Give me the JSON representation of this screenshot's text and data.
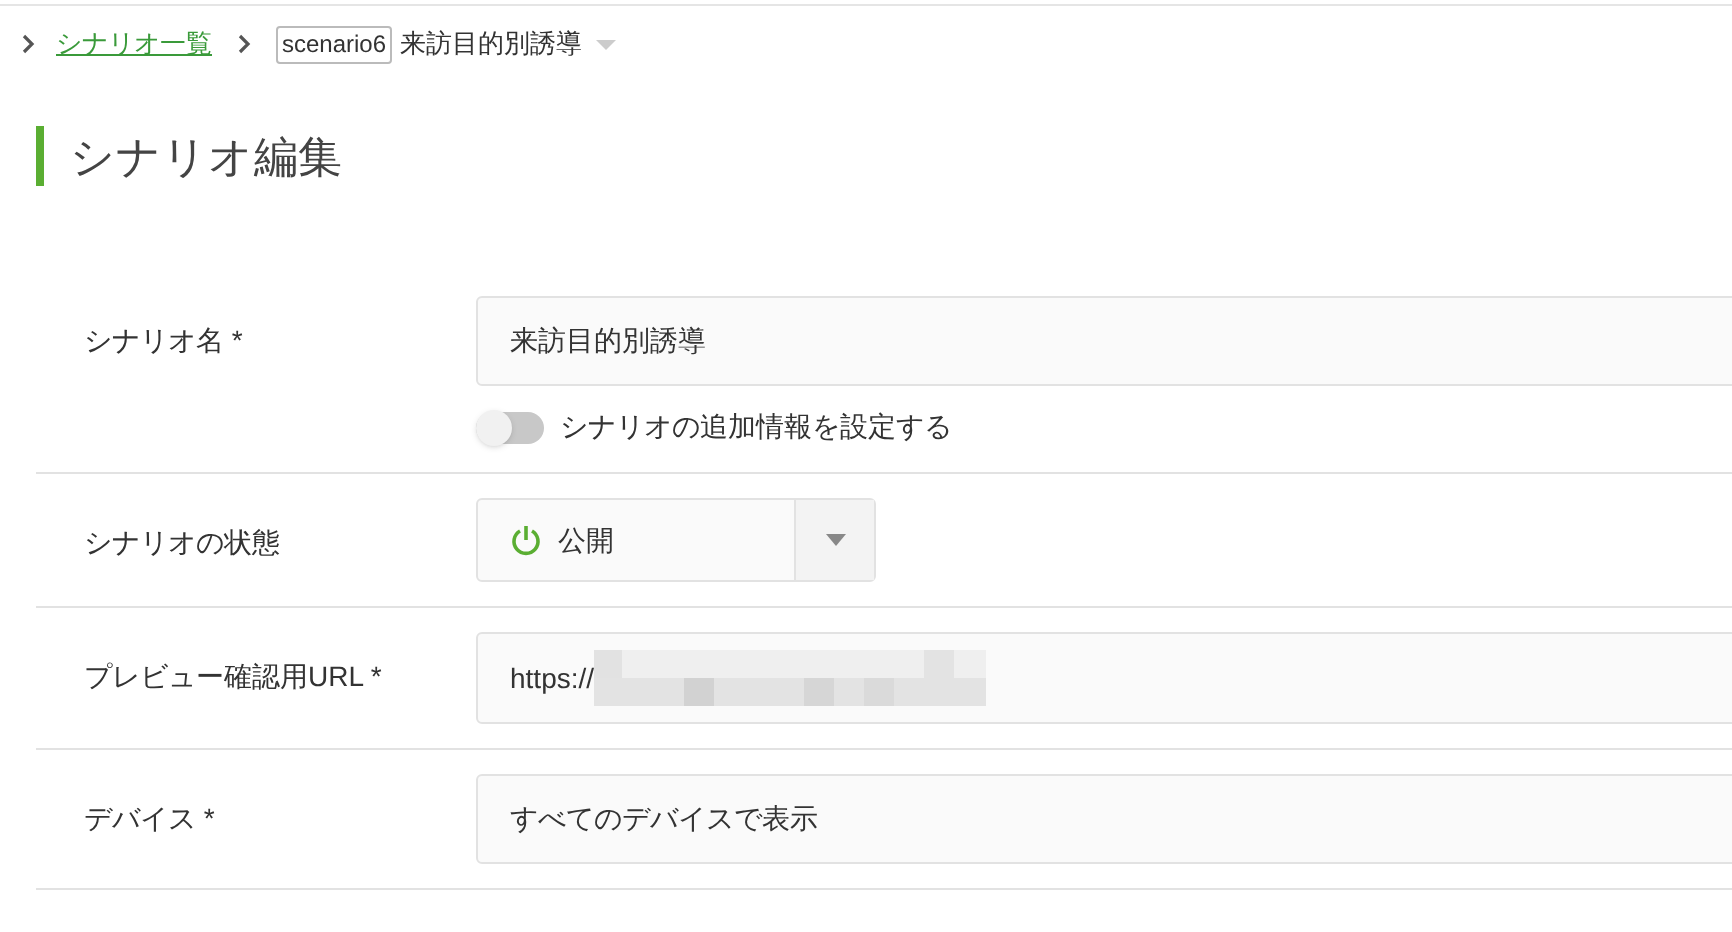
{
  "breadcrumb": {
    "link": "シナリオ一覧",
    "tag": "scenario6",
    "current": "来訪目的別誘導"
  },
  "title": "シナリオ編集",
  "fields": [
    {
      "kind": "text",
      "label": "シナリオ名 *",
      "value": "来訪目的別誘導",
      "toggle": {
        "label": "シナリオの追加情報を設定する",
        "on": false
      }
    },
    {
      "kind": "select",
      "label": "シナリオの状態",
      "value": "公開"
    },
    {
      "kind": "url",
      "label": "プレビュー確認用URL *",
      "value": "https://"
    },
    {
      "kind": "text",
      "label": "デバイス *",
      "value": "すべてのデバイスで表示"
    }
  ]
}
